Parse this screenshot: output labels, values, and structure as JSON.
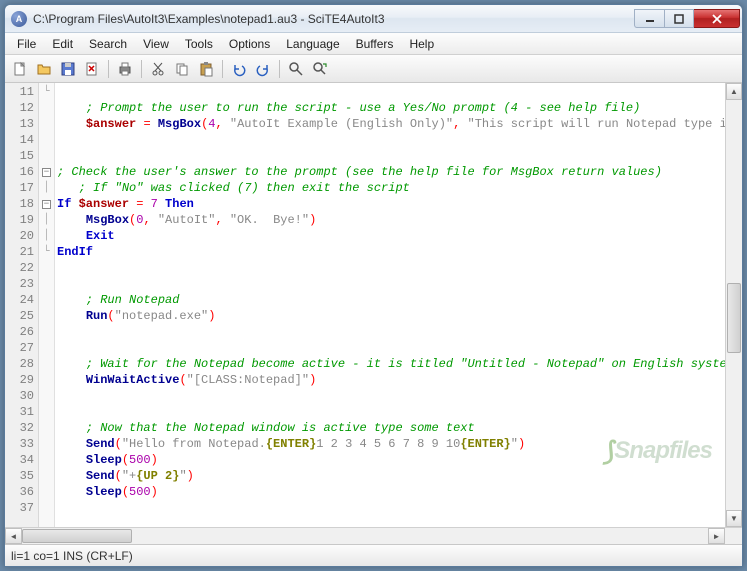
{
  "window": {
    "title": "C:\\Program Files\\AutoIt3\\Examples\\notepad1.au3 - SciTE4AutoIt3"
  },
  "menu": {
    "items": [
      "File",
      "Edit",
      "Search",
      "View",
      "Tools",
      "Options",
      "Language",
      "Buffers",
      "Help"
    ]
  },
  "toolbar": {
    "groups": [
      [
        "new",
        "open",
        "save",
        "close"
      ],
      [
        "print"
      ],
      [
        "cut",
        "copy",
        "paste"
      ],
      [
        "undo",
        "redo"
      ],
      [
        "find",
        "replace"
      ]
    ]
  },
  "status": {
    "text": "li=1 co=1 INS (CR+LF)"
  },
  "watermark": {
    "text": "Snapfiles"
  },
  "code": {
    "first_line": 11,
    "lines": [
      {
        "n": 11,
        "fold": "L",
        "seg": []
      },
      {
        "n": 12,
        "fold": "",
        "seg": [
          {
            "t": "    ",
            "c": ""
          },
          {
            "t": "; Prompt the user to run the script - use a Yes/No prompt (4 - see help file)",
            "c": "c-comment"
          }
        ]
      },
      {
        "n": 13,
        "fold": "",
        "seg": [
          {
            "t": "    ",
            "c": ""
          },
          {
            "t": "$answer",
            "c": "c-var"
          },
          {
            "t": " ",
            "c": ""
          },
          {
            "t": "=",
            "c": "c-op"
          },
          {
            "t": " ",
            "c": ""
          },
          {
            "t": "MsgBox",
            "c": "c-func"
          },
          {
            "t": "(",
            "c": "c-op"
          },
          {
            "t": "4",
            "c": "c-num"
          },
          {
            "t": ",",
            "c": "c-op"
          },
          {
            "t": " ",
            "c": ""
          },
          {
            "t": "\"AutoIt Example (English Only)\"",
            "c": "c-str"
          },
          {
            "t": ",",
            "c": "c-op"
          },
          {
            "t": " ",
            "c": ""
          },
          {
            "t": "\"This script will run Notepad type in s",
            "c": "c-str"
          }
        ]
      },
      {
        "n": 14,
        "fold": "",
        "seg": []
      },
      {
        "n": 15,
        "fold": "",
        "seg": []
      },
      {
        "n": 16,
        "fold": "box",
        "seg": [
          {
            "t": "; Check the user's answer to the prompt (see the help file for MsgBox return values)",
            "c": "c-comment"
          }
        ]
      },
      {
        "n": 17,
        "fold": "|",
        "seg": [
          {
            "t": "   ",
            "c": ""
          },
          {
            "t": "; If \"No\" was clicked (7) then exit the script",
            "c": "c-comment"
          }
        ]
      },
      {
        "n": 18,
        "fold": "box",
        "seg": [
          {
            "t": "If",
            "c": "c-kw"
          },
          {
            "t": " ",
            "c": ""
          },
          {
            "t": "$answer",
            "c": "c-var"
          },
          {
            "t": " ",
            "c": ""
          },
          {
            "t": "=",
            "c": "c-op"
          },
          {
            "t": " ",
            "c": ""
          },
          {
            "t": "7",
            "c": "c-num"
          },
          {
            "t": " ",
            "c": ""
          },
          {
            "t": "Then",
            "c": "c-kw"
          }
        ]
      },
      {
        "n": 19,
        "fold": "|",
        "seg": [
          {
            "t": "    ",
            "c": ""
          },
          {
            "t": "MsgBox",
            "c": "c-func"
          },
          {
            "t": "(",
            "c": "c-op"
          },
          {
            "t": "0",
            "c": "c-num"
          },
          {
            "t": ",",
            "c": "c-op"
          },
          {
            "t": " ",
            "c": ""
          },
          {
            "t": "\"AutoIt\"",
            "c": "c-str"
          },
          {
            "t": ",",
            "c": "c-op"
          },
          {
            "t": " ",
            "c": ""
          },
          {
            "t": "\"OK.  Bye!\"",
            "c": "c-str"
          },
          {
            "t": ")",
            "c": "c-op"
          }
        ]
      },
      {
        "n": 20,
        "fold": "|",
        "seg": [
          {
            "t": "    ",
            "c": ""
          },
          {
            "t": "Exit",
            "c": "c-kw"
          }
        ]
      },
      {
        "n": 21,
        "fold": "L",
        "seg": [
          {
            "t": "EndIf",
            "c": "c-kw"
          }
        ]
      },
      {
        "n": 22,
        "fold": "",
        "seg": []
      },
      {
        "n": 23,
        "fold": "",
        "seg": []
      },
      {
        "n": 24,
        "fold": "",
        "seg": [
          {
            "t": "    ",
            "c": ""
          },
          {
            "t": "; Run Notepad",
            "c": "c-comment"
          }
        ]
      },
      {
        "n": 25,
        "fold": "",
        "seg": [
          {
            "t": "    ",
            "c": ""
          },
          {
            "t": "Run",
            "c": "c-func"
          },
          {
            "t": "(",
            "c": "c-op"
          },
          {
            "t": "\"notepad.exe\"",
            "c": "c-str"
          },
          {
            "t": ")",
            "c": "c-op"
          }
        ]
      },
      {
        "n": 26,
        "fold": "",
        "seg": []
      },
      {
        "n": 27,
        "fold": "",
        "seg": []
      },
      {
        "n": 28,
        "fold": "",
        "seg": [
          {
            "t": "    ",
            "c": ""
          },
          {
            "t": "; Wait for the Notepad become active - it is titled \"Untitled - Notepad\" on English systems",
            "c": "c-comment"
          }
        ]
      },
      {
        "n": 29,
        "fold": "",
        "seg": [
          {
            "t": "    ",
            "c": ""
          },
          {
            "t": "WinWaitActive",
            "c": "c-func"
          },
          {
            "t": "(",
            "c": "c-op"
          },
          {
            "t": "\"[CLASS:Notepad]\"",
            "c": "c-str"
          },
          {
            "t": ")",
            "c": "c-op"
          }
        ]
      },
      {
        "n": 30,
        "fold": "",
        "seg": []
      },
      {
        "n": 31,
        "fold": "",
        "seg": []
      },
      {
        "n": 32,
        "fold": "",
        "seg": [
          {
            "t": "    ",
            "c": ""
          },
          {
            "t": "; Now that the Notepad window is active type some text",
            "c": "c-comment"
          }
        ]
      },
      {
        "n": 33,
        "fold": "",
        "seg": [
          {
            "t": "    ",
            "c": ""
          },
          {
            "t": "Send",
            "c": "c-func"
          },
          {
            "t": "(",
            "c": "c-op"
          },
          {
            "t": "\"Hello from Notepad.",
            "c": "c-str"
          },
          {
            "t": "{ENTER}",
            "c": "c-macro"
          },
          {
            "t": "1 2 3 4 5 6 7 8 9 10",
            "c": "c-str"
          },
          {
            "t": "{ENTER}",
            "c": "c-macro"
          },
          {
            "t": "\"",
            "c": "c-str"
          },
          {
            "t": ")",
            "c": "c-op"
          }
        ]
      },
      {
        "n": 34,
        "fold": "",
        "seg": [
          {
            "t": "    ",
            "c": ""
          },
          {
            "t": "Sleep",
            "c": "c-func"
          },
          {
            "t": "(",
            "c": "c-op"
          },
          {
            "t": "500",
            "c": "c-num"
          },
          {
            "t": ")",
            "c": "c-op"
          }
        ]
      },
      {
        "n": 35,
        "fold": "",
        "seg": [
          {
            "t": "    ",
            "c": ""
          },
          {
            "t": "Send",
            "c": "c-func"
          },
          {
            "t": "(",
            "c": "c-op"
          },
          {
            "t": "\"+",
            "c": "c-str"
          },
          {
            "t": "{UP 2}",
            "c": "c-macro"
          },
          {
            "t": "\"",
            "c": "c-str"
          },
          {
            "t": ")",
            "c": "c-op"
          }
        ]
      },
      {
        "n": 36,
        "fold": "",
        "seg": [
          {
            "t": "    ",
            "c": ""
          },
          {
            "t": "Sleep",
            "c": "c-func"
          },
          {
            "t": "(",
            "c": "c-op"
          },
          {
            "t": "500",
            "c": "c-num"
          },
          {
            "t": ")",
            "c": "c-op"
          }
        ]
      },
      {
        "n": 37,
        "fold": "",
        "seg": []
      }
    ]
  }
}
